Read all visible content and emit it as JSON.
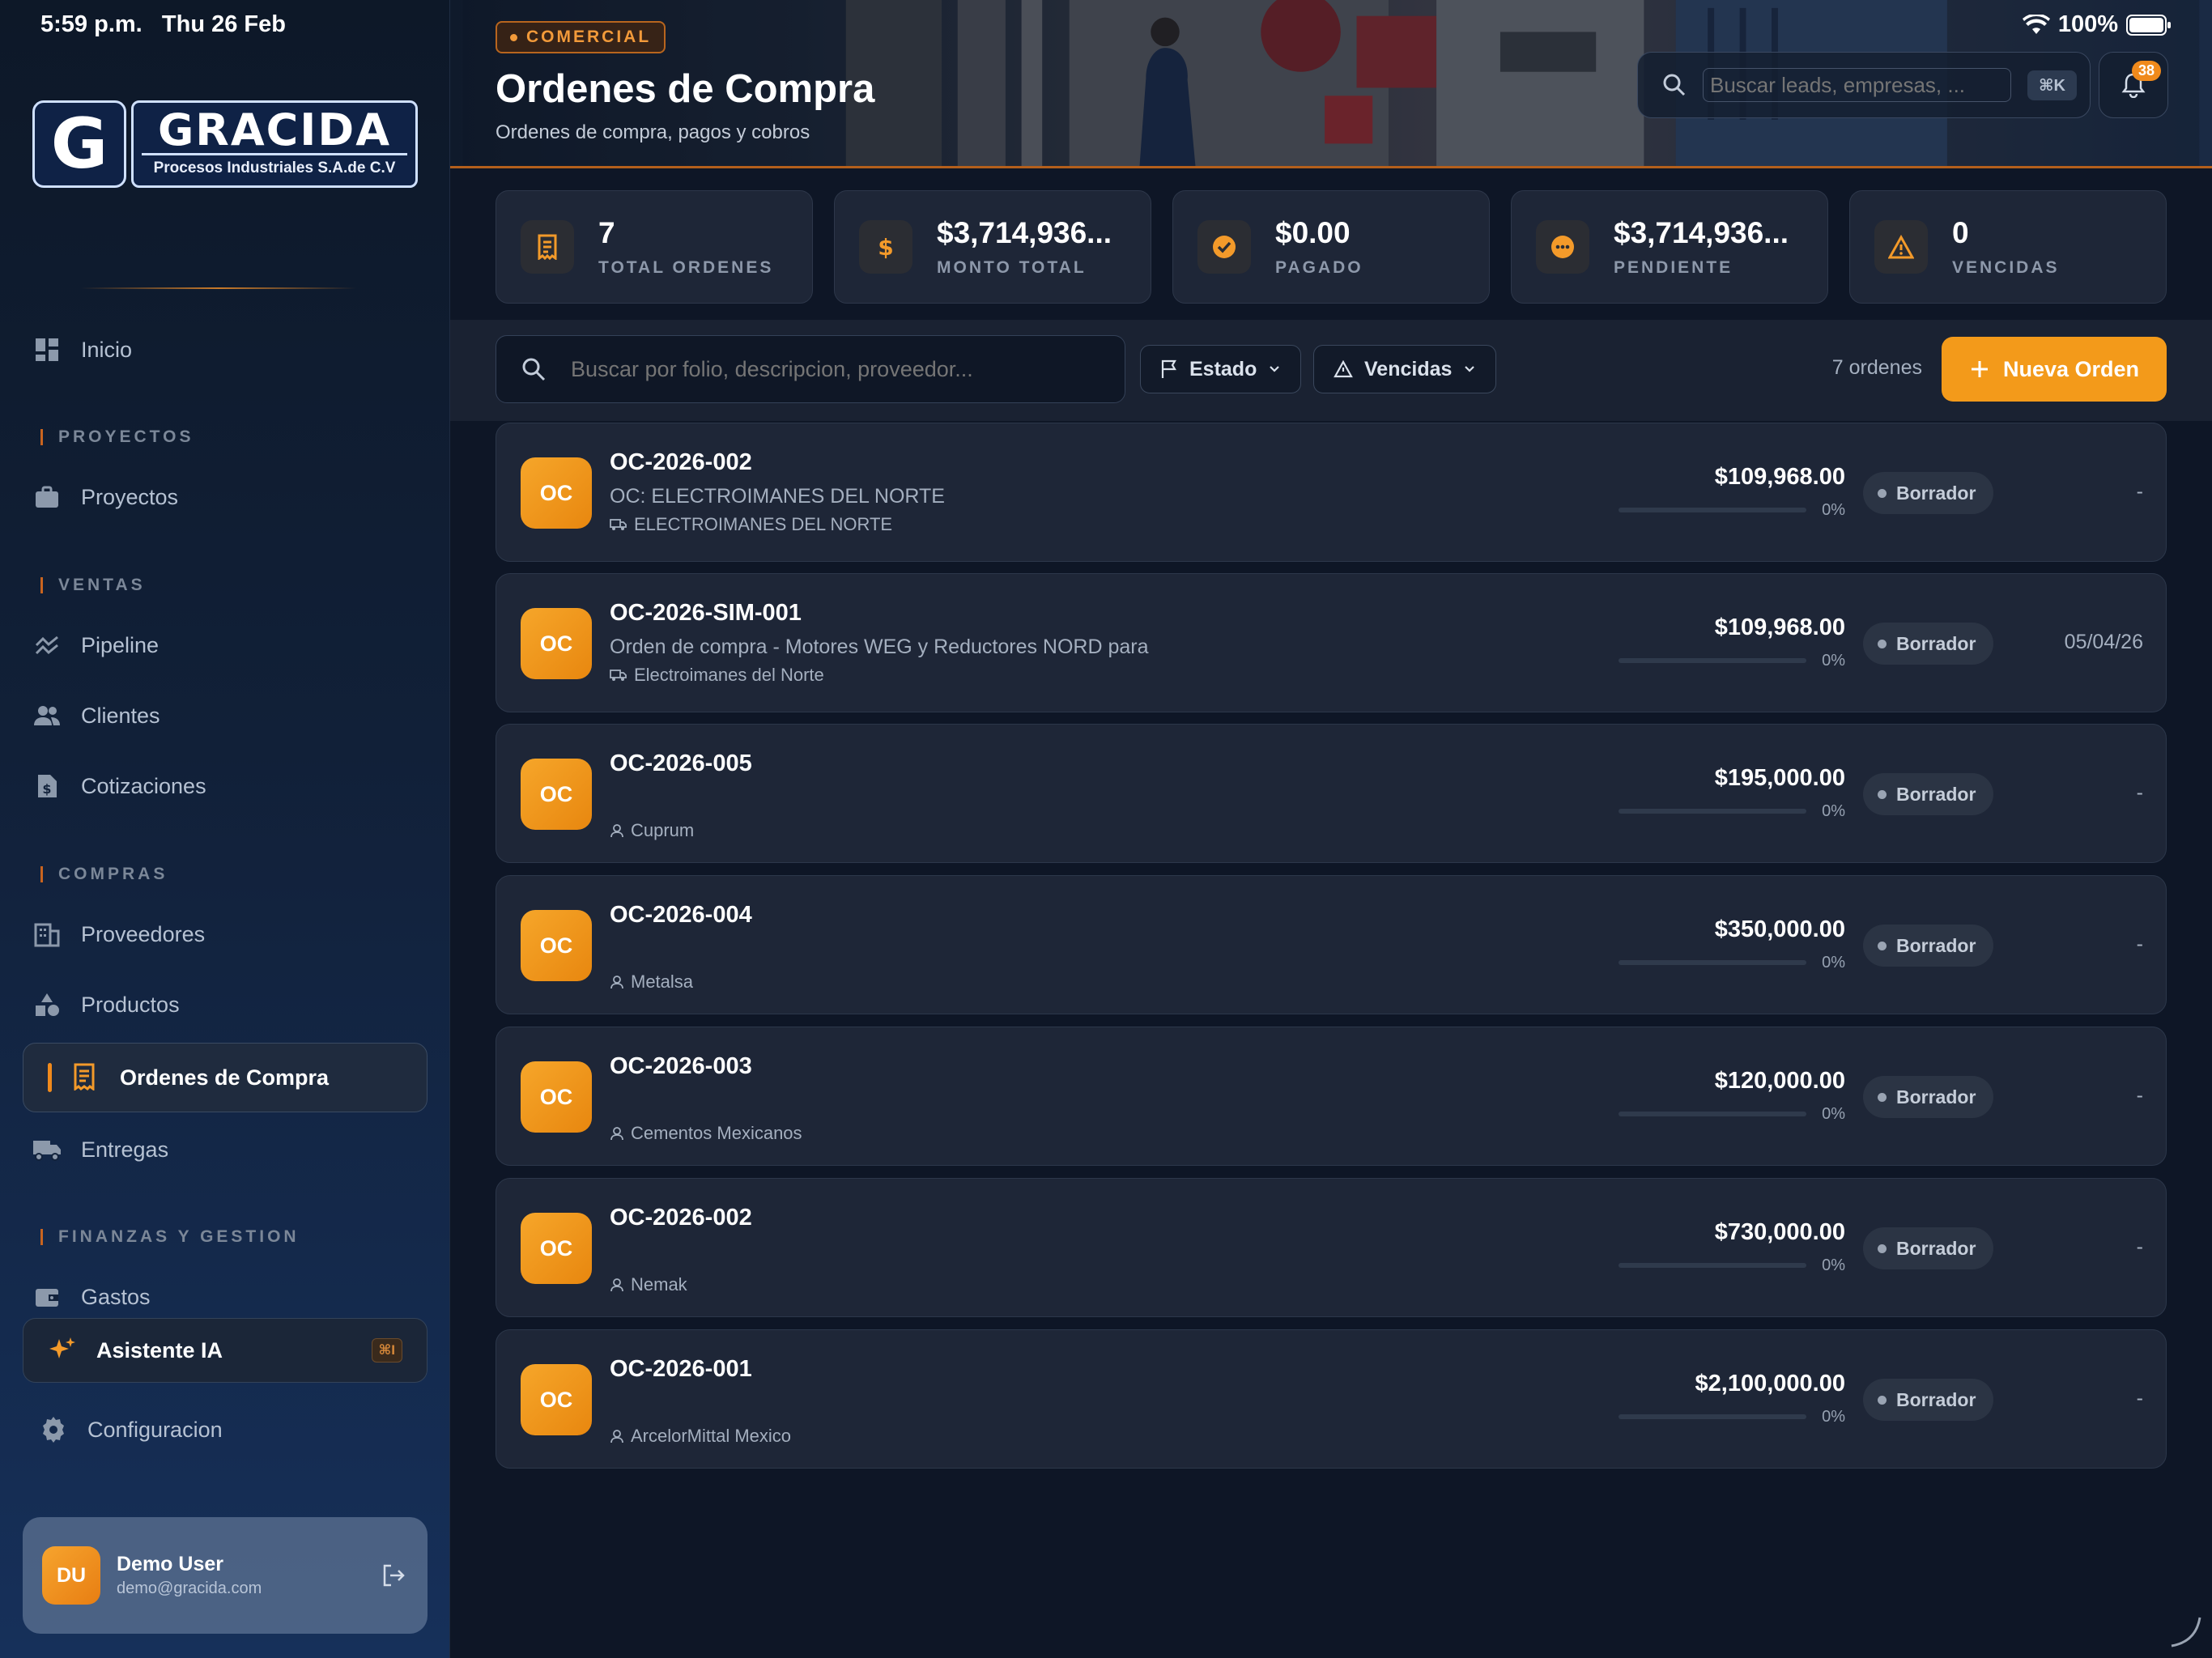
{
  "status_bar": {
    "time": "5:59 p.m.",
    "date": "Thu 26 Feb",
    "battery": "100%"
  },
  "sidebar": {
    "logo": {
      "brand": "GRACIDA",
      "letter": "G",
      "subtitle": "Procesos Industriales S.A.de C.V"
    },
    "home": {
      "label": "Inicio",
      "icon": "dashboard-icon"
    },
    "sections": {
      "proyectos": "PROYECTOS",
      "ventas": "VENTAS",
      "compras": "COMPRAS",
      "finanzas": "FINANZAS Y GESTION"
    },
    "items": {
      "proyectos": "Proyectos",
      "pipeline": "Pipeline",
      "clientes": "Clientes",
      "cotizaciones": "Cotizaciones",
      "proveedores": "Proveedores",
      "productos": "Productos",
      "ordenes": "Ordenes de Compra",
      "entregas": "Entregas",
      "gastos": "Gastos"
    },
    "assistant": {
      "label": "Asistente IA",
      "shortcut": "⌘I"
    },
    "config": "Configuracion",
    "user": {
      "initials": "DU",
      "name": "Demo User",
      "email": "demo@gracida.com"
    }
  },
  "header": {
    "badge": "COMERCIAL",
    "title": "Ordenes de Compra",
    "subtitle": "Ordenes de compra, pagos y cobros",
    "search_placeholder": "Buscar leads, empresas, ...",
    "search_shortcut": "⌘K",
    "notifications": "38"
  },
  "stats": [
    {
      "value": "7",
      "label": "TOTAL ORDENES",
      "icon": "receipt-icon"
    },
    {
      "value": "$3,714,936...",
      "label": "MONTO TOTAL",
      "icon": "dollar-icon"
    },
    {
      "value": "$0.00",
      "label": "PAGADO",
      "icon": "check-circle-icon"
    },
    {
      "value": "$3,714,936...",
      "label": "PENDIENTE",
      "icon": "pending-icon"
    },
    {
      "value": "0",
      "label": "VENCIDAS",
      "icon": "warning-icon"
    }
  ],
  "filters": {
    "search_placeholder": "Buscar por folio, descripcion, proveedor...",
    "estado": "Estado",
    "vencidas": "Vencidas",
    "count": "7 ordenes",
    "new_button": "Nueva Orden"
  },
  "orders": [
    {
      "badge": "OC",
      "folio": "OC-2026-002",
      "description": "OC: ELECTROIMANES DEL NORTE",
      "provider": "ELECTROIMANES DEL NORTE",
      "provider_icon": "truck-icon",
      "amount": "$109,968.00",
      "progress": 0,
      "progress_label": "0%",
      "status": "Borrador",
      "date": "-"
    },
    {
      "badge": "OC",
      "folio": "OC-2026-SIM-001",
      "description": "Orden de compra - Motores WEG y Reductores NORD para",
      "provider": "Electroimanes del Norte",
      "provider_icon": "truck-icon",
      "amount": "$109,968.00",
      "progress": 0,
      "progress_label": "0%",
      "status": "Borrador",
      "date": "05/04/26"
    },
    {
      "badge": "OC",
      "folio": "OC-2026-005",
      "description": "",
      "provider": "Cuprum",
      "provider_icon": "person-icon",
      "amount": "$195,000.00",
      "progress": 0,
      "progress_label": "0%",
      "status": "Borrador",
      "date": "-"
    },
    {
      "badge": "OC",
      "folio": "OC-2026-004",
      "description": "",
      "provider": "Metalsa",
      "provider_icon": "person-icon",
      "amount": "$350,000.00",
      "progress": 0,
      "progress_label": "0%",
      "status": "Borrador",
      "date": "-"
    },
    {
      "badge": "OC",
      "folio": "OC-2026-003",
      "description": "",
      "provider": "Cementos Mexicanos",
      "provider_icon": "person-icon",
      "amount": "$120,000.00",
      "progress": 0,
      "progress_label": "0%",
      "status": "Borrador",
      "date": "-"
    },
    {
      "badge": "OC",
      "folio": "OC-2026-002",
      "description": "",
      "provider": "Nemak",
      "provider_icon": "person-icon",
      "amount": "$730,000.00",
      "progress": 0,
      "progress_label": "0%",
      "status": "Borrador",
      "date": "-"
    },
    {
      "badge": "OC",
      "folio": "OC-2026-001",
      "description": "",
      "provider": "ArcelorMittal Mexico",
      "provider_icon": "person-icon",
      "amount": "$2,100,000.00",
      "progress": 0,
      "progress_label": "0%",
      "status": "Borrador",
      "date": "-"
    }
  ],
  "colors": {
    "accent": "#f39a1a",
    "background": "#0e1626",
    "card": "#1e2637"
  }
}
